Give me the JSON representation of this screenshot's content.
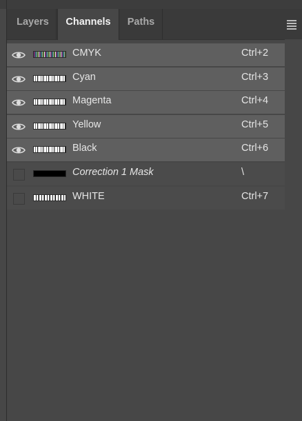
{
  "tabs": [
    {
      "label": "Layers",
      "active": false
    },
    {
      "label": "Channels",
      "active": true
    },
    {
      "label": "Paths",
      "active": false
    }
  ],
  "channels": [
    {
      "name": "CMYK",
      "shortcut": "Ctrl+2",
      "visible": true,
      "italic": false,
      "thumb": "cmyk"
    },
    {
      "name": "Cyan",
      "shortcut": "Ctrl+3",
      "visible": true,
      "italic": false,
      "thumb": "cyan"
    },
    {
      "name": "Magenta",
      "shortcut": "Ctrl+4",
      "visible": true,
      "italic": false,
      "thumb": "magenta"
    },
    {
      "name": "Yellow",
      "shortcut": "Ctrl+5",
      "visible": true,
      "italic": false,
      "thumb": "yellow"
    },
    {
      "name": "Black",
      "shortcut": "Ctrl+6",
      "visible": true,
      "italic": false,
      "thumb": "black"
    },
    {
      "name": "Correction 1 Mask",
      "shortcut": "\\",
      "visible": false,
      "italic": true,
      "thumb": "mask"
    },
    {
      "name": "WHITE",
      "shortcut": "Ctrl+7",
      "visible": false,
      "italic": false,
      "thumb": "white"
    }
  ],
  "icons": {
    "visibility": "eye-icon",
    "panel_menu": "panel-menu-icon"
  },
  "colors": {
    "panel_bg": "#474747",
    "tab_bar_bg": "#3a3a3a",
    "row_visible_bg": "#5f5f5f",
    "row_hidden_bg": "#4b4b4b",
    "text": "#e6e6e6"
  }
}
